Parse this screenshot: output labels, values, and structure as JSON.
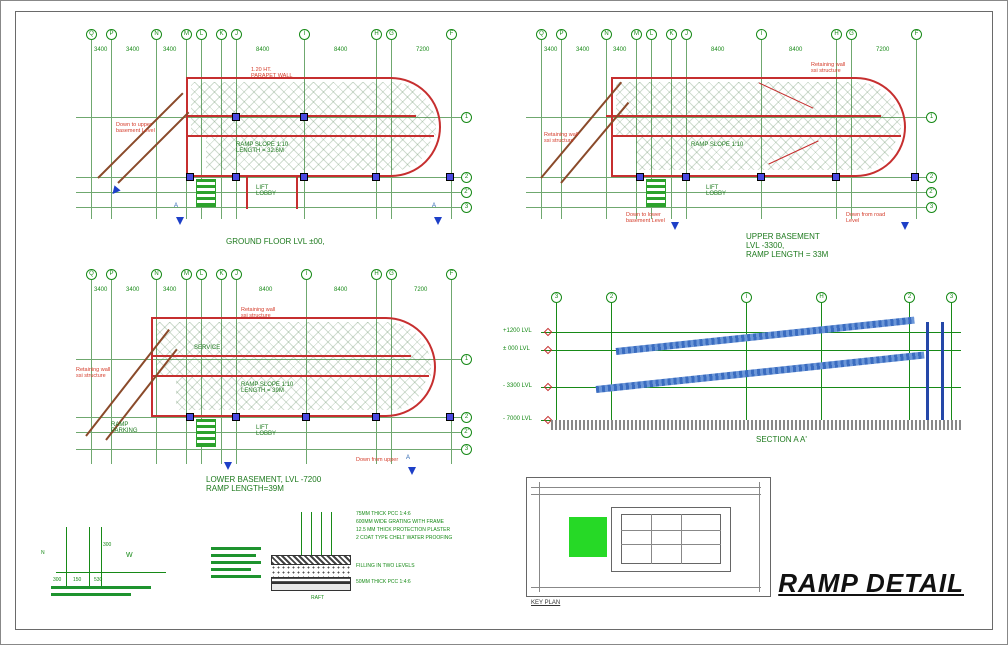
{
  "main_title": "RAMP DETAIL",
  "grid_labels": [
    "Q",
    "P",
    "N",
    "M",
    "L",
    "K",
    "J",
    "I",
    "H",
    "G",
    "F"
  ],
  "grid_row_labels": [
    "1",
    "2",
    "2'",
    "3"
  ],
  "dims_top": [
    "3400",
    "3400",
    "3400",
    "8400",
    "8400",
    "8400",
    "7200"
  ],
  "plans": {
    "ground": {
      "title": "GROUND FLOOR LVL ±00,",
      "room": "LIFT\nLOBBY",
      "ramp_note": "RAMP SLOPE 1:10\nLENGTH = 32.6M",
      "parapet": "1.20 HT.\nPARAPET WALL",
      "down_note": "Down to upper\nbasement Level",
      "section_marks": [
        "A",
        "A"
      ]
    },
    "upper": {
      "title": "UPPER BASEMENT\nLVL -3300,\nRAMP LENGTH = 33M",
      "room": "LIFT\nLOBBY",
      "ramp_note": "RAMP SLOPE 1:10",
      "retaining": "Retaining wall\nssi structure",
      "down_note1": "Down to lower\nbasement Level",
      "down_note2": "Down from road\nLevel",
      "section_marks": [
        "A",
        "A"
      ]
    },
    "lower": {
      "title": "LOWER BASEMENT, LVL -7200\nRAMP LENGTH=39M",
      "room": "LIFT\nLOBBY",
      "ramp_note": "RAMP SLOPE 1:10\nLENGTH = 39M",
      "retaining": "Retaining wall\nssi structure",
      "service": "SERVICE",
      "ramp_parking": "RAMP\nPARKING",
      "down_note": "Down from upper",
      "section_marks": [
        "A",
        "A"
      ]
    }
  },
  "section": {
    "title": "SECTION A A'",
    "levels": [
      "+1200 LVL",
      "± 000 LVL",
      "- 3300 LVL",
      "- 7000 LVL"
    ],
    "grid": [
      "3",
      "2",
      "I",
      "H",
      "2",
      "3"
    ]
  },
  "detail_small": {
    "title_left": "",
    "labels": [
      "75MM THICK PCC 1:4:6",
      "600MM WIDE GRATING WITH FRAME",
      "12.5 MM THICK PROTECTION PLASTER",
      "2 COAT TYPE CHELT WATER PROOFING",
      "FILLING IN TWO LEVELS",
      "50MM THICK PCC 1:4:6",
      "RAFT"
    ],
    "bottom_label": ""
  },
  "detail_left": {
    "dims": [
      "300",
      "300",
      "150",
      "530"
    ],
    "label": "W",
    "arrow": "N"
  },
  "keyplan": {
    "title": "KEY PLAN"
  }
}
